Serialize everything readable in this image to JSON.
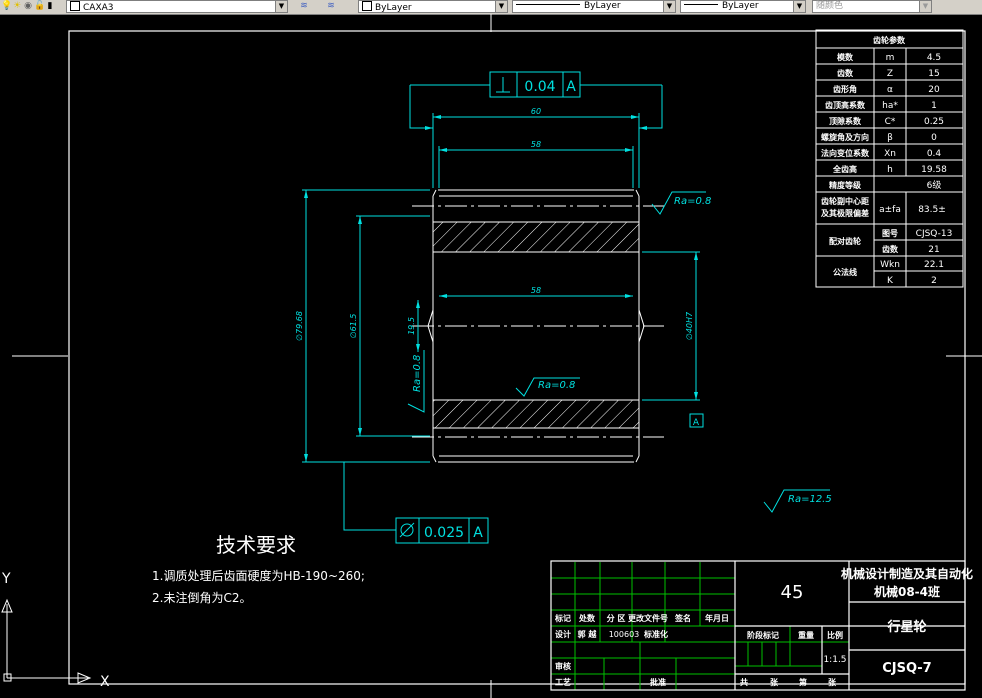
{
  "toolbar": {
    "layer_name": "CAXA3",
    "color_value": "ByLayer",
    "linetype_value": "ByLayer",
    "lineweight_value": "ByLayer",
    "plotstyle_value": "随颜色"
  },
  "drawing": {
    "tolerance_top": {
      "value": "0.04",
      "datum": "A"
    },
    "tolerance_bottom": {
      "value": "0.025",
      "datum": "A"
    },
    "dim_60": "60",
    "dim_58_top": "58",
    "dim_58_mid": "58",
    "dim_outer_dia": "∅79.68",
    "dim_inner_dia": "∅61.5",
    "dim_bore": "∅40H7",
    "dim_small": "19.5",
    "ra_top": "Ra=0.8",
    "ra_left": "Ra=0.8",
    "ra_mid": "Ra=0.8",
    "ra_general": "Ra=12.5",
    "datum_label": "A",
    "ucs_x": "X",
    "ucs_y": "Y"
  },
  "params": {
    "title": "齿轮参数",
    "rows": [
      {
        "name": "模数",
        "sym": "m",
        "val": "4.5"
      },
      {
        "name": "齿数",
        "sym": "Z",
        "val": "15"
      },
      {
        "name": "齿形角",
        "sym": "α",
        "val": "20"
      },
      {
        "name": "齿顶高系数",
        "sym": "ha*",
        "val": "1"
      },
      {
        "name": "顶隙系数",
        "sym": "C*",
        "val": "0.25"
      },
      {
        "name": "螺旋角及方向",
        "sym": "β",
        "val": "0"
      },
      {
        "name": "法向变位系数",
        "sym": "Xn",
        "val": "0.4"
      },
      {
        "name": "全齿高",
        "sym": "h",
        "val": "19.58"
      }
    ],
    "precision_name": "精度等级",
    "precision_val": "6级",
    "center_name_1": "齿轮副中心距",
    "center_name_2": "及其极限偏差",
    "center_sym": "a±fa",
    "center_val": "83.5±",
    "mating_name": "配对齿轮",
    "mating_rows": [
      {
        "sym": "图号",
        "val": "CJSQ-13"
      },
      {
        "sym": "齿数",
        "val": "21"
      }
    ],
    "common_name": "公法线",
    "common_rows": [
      {
        "sym": "Wkn",
        "val": "22.1"
      },
      {
        "sym": "K",
        "val": "2"
      }
    ]
  },
  "tech": {
    "title": "技术要求",
    "lines": [
      "1.调质处理后齿面硬度为HB-190~260;",
      "2.未注倒角为C2。"
    ]
  },
  "titleblock": {
    "material": "45",
    "school_1": "机械设计制造及其自动化",
    "school_2": "机械08-4班",
    "part_name": "行星轮",
    "drawing_no": "CJSQ-7",
    "scale": "1:1.5",
    "h_mark": "标记",
    "h_count": "处数",
    "h_zone": "分 区",
    "h_doc": "更改文件号",
    "h_sign": "签名",
    "h_date": "年月日",
    "design_label": "设计",
    "designer": "郭 越",
    "design_date": "100603",
    "standard_label": "标准化",
    "stage_label": "阶段标记",
    "weight_label": "重量",
    "scale_label": "比例",
    "review_label": "审核",
    "process_label": "工艺",
    "approve_label": "批准",
    "total_label": "共",
    "sheets_label": "张",
    "nth_label": "第",
    "sheet2_label": "张"
  }
}
